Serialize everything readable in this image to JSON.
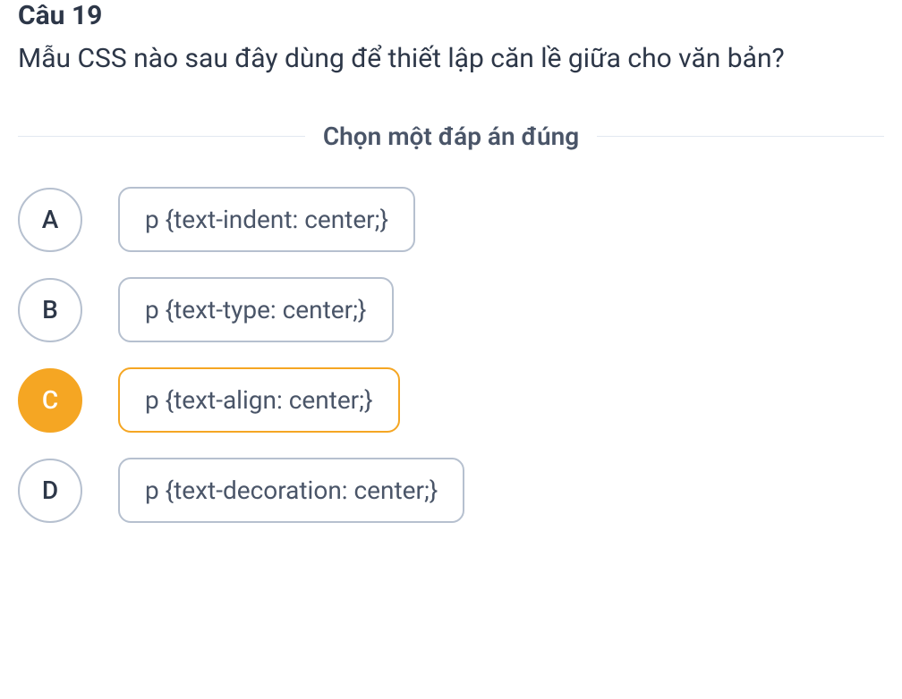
{
  "question": {
    "number": "Câu 19",
    "text": "Mẫu CSS nào sau đây dùng để thiết lập căn lề giữa cho văn bản?"
  },
  "instruction": "Chọn một đáp án đúng",
  "options": [
    {
      "letter": "A",
      "text": "p {text-indent: center;}",
      "selected": false
    },
    {
      "letter": "B",
      "text": "p {text-type: center;}",
      "selected": false
    },
    {
      "letter": "C",
      "text": "p {text-align: center;}",
      "selected": true
    },
    {
      "letter": "D",
      "text": "p {text-decoration: center;}",
      "selected": false
    }
  ]
}
